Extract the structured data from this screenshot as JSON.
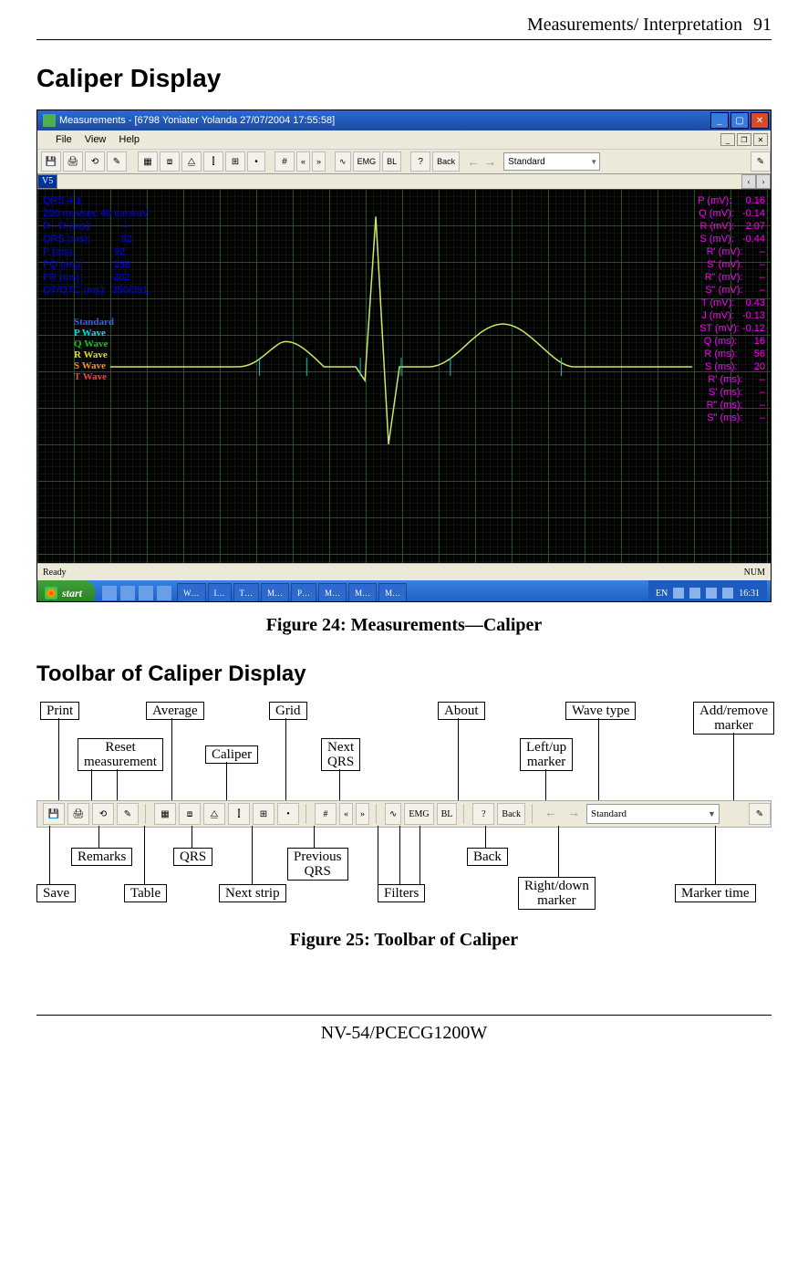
{
  "header": {
    "section": "Measurements/ Interpretation",
    "page": "91"
  },
  "title_caliper_display": "Caliper Display",
  "window": {
    "title": "Measurements - [6798 Yoniater Yolanda  27/07/2004 17:55:58]",
    "menu": [
      "File",
      "View",
      "Help"
    ],
    "toolbar_prevnext": {
      "prev": "«",
      "next": "»"
    },
    "toolbar_filter_labels": [
      "∿",
      "EMG",
      "BL"
    ],
    "toolbar_back_label": "Back",
    "wave_dropdown": "Standard",
    "lead_label": "V5",
    "status_left": "Ready",
    "status_right": "NUM"
  },
  "ecg_left_measurements": [
    "QRS # 1",
    "",
    "200 mm/sec 40 mm/mV",
    "",
    "R - R (ms):           –",
    "",
    "QRS (ms):           92",
    "P (ms):              92",
    "PQ (ms):           158",
    "PR (ms):           202",
    "QT/QTC (ms):  350/391"
  ],
  "wave_legend": [
    {
      "label": "Standard",
      "color": "#00f"
    },
    {
      "label": "P Wave",
      "color": "#0ff"
    },
    {
      "label": "Q Wave",
      "color": "#0f0"
    },
    {
      "label": "R Wave",
      "color": "#ff0"
    },
    {
      "label": "S Wave",
      "color": "#f80"
    },
    {
      "label": "T Wave",
      "color": "#f55"
    }
  ],
  "ecg_right_measurements": [
    "P (mV):     0.16",
    "Q (mV):   -0.14",
    "R (mV):    2.07",
    "S (mV):   -0.44",
    "R' (mV):      –",
    "S' (mV):      –",
    "R\" (mV):      –",
    "S\" (mV):      –",
    "T (mV):    0.43",
    "J (mV):   -0.13",
    "ST (mV): -0.12",
    "Q (ms):      16",
    "R (ms):      56",
    "S (ms):      20",
    "R' (ms):      –",
    "S' (ms):      –",
    "R\" (ms):      –",
    "S\" (ms):      –"
  ],
  "taskbar": {
    "start": "start",
    "tasks": [
      "W…",
      "I…",
      "T…",
      "M…",
      "P…",
      "M…",
      "M…",
      "M…"
    ],
    "lang": "EN",
    "clock": "16:31"
  },
  "figure24_caption": "Figure 24: Measurements—Caliper",
  "title_toolbar": "Toolbar of Caliper Display",
  "labels_top": {
    "print": "Print",
    "average": "Average",
    "grid": "Grid",
    "about": "About",
    "wave_type": "Wave type",
    "add_remove_marker": "Add/remove\nmarker"
  },
  "labels_top2": {
    "reset_measurement": "Reset\nmeasurement",
    "caliper": "Caliper",
    "next_qrs": "Next\nQRS",
    "left_up_marker": "Left/up\nmarker"
  },
  "labels_bot1": {
    "remarks": "Remarks",
    "qrs": "QRS",
    "previous_qrs": "Previous\nQRS",
    "back": "Back"
  },
  "labels_bot2": {
    "save": "Save",
    "table": "Table",
    "next_strip": "Next strip",
    "filters": "Filters",
    "right_down_marker": "Right/down\nmarker",
    "marker_time": "Marker time"
  },
  "toolbar2_dropdown": "Standard",
  "figure25_caption": "Figure 25: Toolbar of Caliper",
  "footer": "NV-54/PCECG1200W"
}
